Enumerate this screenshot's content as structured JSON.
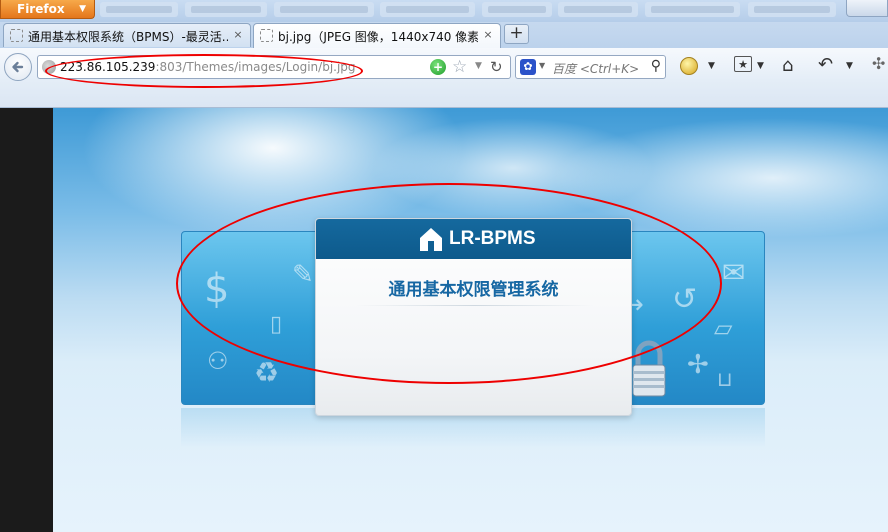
{
  "browser": {
    "app_button_label": "Firefox",
    "tabs": [
      {
        "title": "通用基本权限系统（BPMS）-最灵活...",
        "active": false
      },
      {
        "title": "bj.jpg（JPEG 图像，1440x740 像素...",
        "active": true
      }
    ],
    "new_tab_label": "+",
    "tab_close_glyph": "×"
  },
  "navbar": {
    "url_host": "223.86.105.239",
    "url_path": ":803/Themes/images/Login/bj.jpg",
    "search_placeholder": "百度 <Ctrl+K>",
    "icons": [
      "back-icon",
      "site-identity-icon",
      "go-icon",
      "bookmark-star-icon",
      "dropdown-icon",
      "reload-icon",
      "search-engine-icon",
      "magnifier-icon",
      "addon-icon",
      "menu-dropdown-icon",
      "bookmarks-icon",
      "home-icon",
      "undo-icon"
    ]
  },
  "page": {
    "logo_text": "LR-BPMS",
    "title": "通用基本权限管理系统"
  },
  "colors": {
    "accent_blue": "#15699e",
    "annotation_red": "#ee0000",
    "firefox_orange": "#e4761b"
  }
}
